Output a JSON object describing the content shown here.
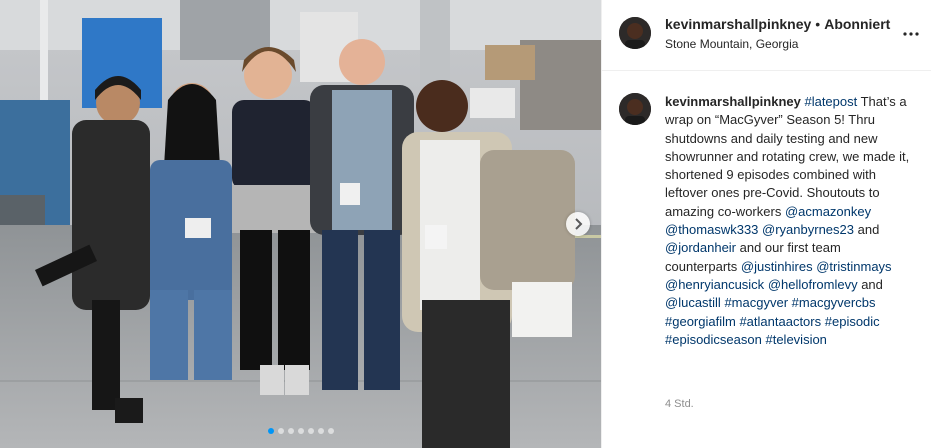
{
  "post": {
    "photo": {
      "carousel": {
        "total": 7,
        "active_index": 0
      }
    },
    "author": {
      "username": "kevinmarshallpinkney",
      "follow_state": "Abonniert",
      "separator": "•",
      "location": "Stone Mountain, Georgia"
    },
    "caption": {
      "segments": [
        {
          "type": "tag",
          "text": "#latepost"
        },
        {
          "type": "text",
          "text": " That’s a wrap on “MacGyver” Season 5! Thru shutdowns and daily testing and new showrunner and rotating crew, we made it, shortened 9 episodes combined with leftover ones pre-Covid. Shoutouts to amazing co-workers "
        },
        {
          "type": "mention",
          "text": "@acmazonkey"
        },
        {
          "type": "text",
          "text": " "
        },
        {
          "type": "mention",
          "text": "@thomaswk333"
        },
        {
          "type": "text",
          "text": " "
        },
        {
          "type": "mention",
          "text": "@ryanbyrnes23"
        },
        {
          "type": "text",
          "text": " and "
        },
        {
          "type": "mention",
          "text": "@jordanheir"
        },
        {
          "type": "text",
          "text": " and our first team counterparts "
        },
        {
          "type": "mention",
          "text": "@justinhires"
        },
        {
          "type": "text",
          "text": " "
        },
        {
          "type": "mention",
          "text": "@tristinmays"
        },
        {
          "type": "text",
          "text": " "
        },
        {
          "type": "mention",
          "text": "@henryiancusick"
        },
        {
          "type": "text",
          "text": " "
        },
        {
          "type": "mention",
          "text": "@hellofromlevy"
        },
        {
          "type": "text",
          "text": " and "
        },
        {
          "type": "mention",
          "text": "@lucastill"
        },
        {
          "type": "text",
          "text": " "
        },
        {
          "type": "tag",
          "text": "#macgyver"
        },
        {
          "type": "text",
          "text": " "
        },
        {
          "type": "tag",
          "text": "#macgyvercbs"
        },
        {
          "type": "text",
          "text": " "
        },
        {
          "type": "tag",
          "text": "#georgiafilm"
        },
        {
          "type": "text",
          "text": " "
        },
        {
          "type": "tag",
          "text": "#atlantaactors"
        },
        {
          "type": "text",
          "text": " "
        },
        {
          "type": "tag",
          "text": "#episodic"
        },
        {
          "type": "text",
          "text": " "
        },
        {
          "type": "tag",
          "text": "#episodicseason"
        },
        {
          "type": "text",
          "text": " "
        },
        {
          "type": "tag",
          "text": "#television"
        }
      ]
    },
    "timestamp": "4 Std."
  },
  "colors": {
    "link": "#00376b",
    "text": "#262626",
    "muted": "#8e8e8e",
    "carousel_active": "#0095f6",
    "border": "#efefef"
  },
  "icons": {
    "more": "more-options-icon",
    "next": "chevron-right-icon"
  }
}
